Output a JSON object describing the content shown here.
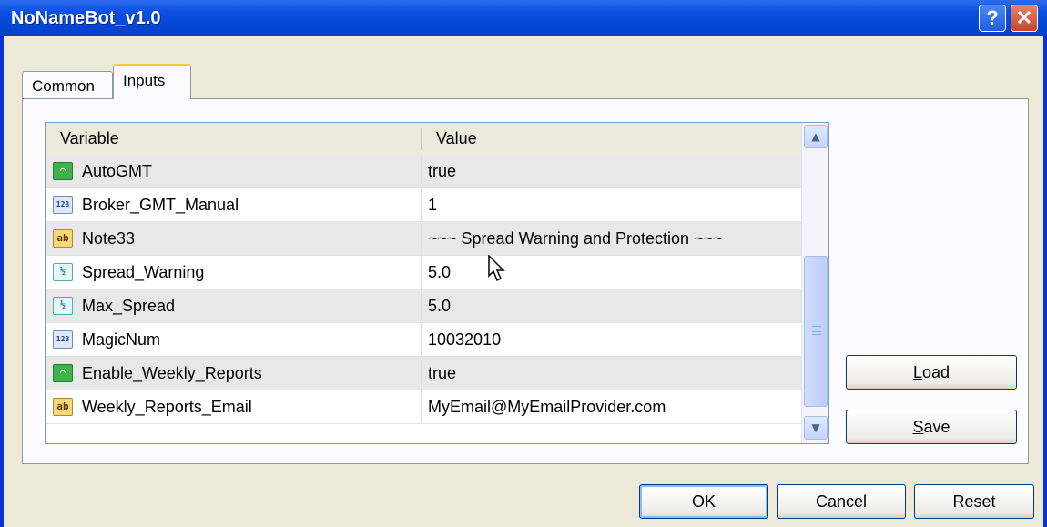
{
  "window": {
    "title": "NoNameBot_v1.0",
    "help_label": "?",
    "close_label": "✕"
  },
  "tabs": [
    {
      "label": "Common",
      "active": false
    },
    {
      "label": "Inputs",
      "active": true
    }
  ],
  "grid": {
    "columns": [
      "Variable",
      "Value"
    ],
    "rows": [
      {
        "icon": "bool",
        "name": "AutoGMT",
        "value": "true"
      },
      {
        "icon": "int",
        "name": "Broker_GMT_Manual",
        "value": "1"
      },
      {
        "icon": "string",
        "name": "Note33",
        "value": "~~~ Spread Warning and Protection ~~~"
      },
      {
        "icon": "double",
        "name": "Spread_Warning",
        "value": "5.0"
      },
      {
        "icon": "double",
        "name": "Max_Spread",
        "value": "5.0"
      },
      {
        "icon": "int",
        "name": "MagicNum",
        "value": "10032010"
      },
      {
        "icon": "bool",
        "name": "Enable_Weekly_Reports",
        "value": "true"
      },
      {
        "icon": "string",
        "name": "Weekly_Reports_Email",
        "value": "MyEmail@MyEmailProvider.com"
      }
    ],
    "icon_glyphs": {
      "bool": "⌒",
      "int": "123",
      "string": "ab",
      "double": "½"
    }
  },
  "side_buttons": {
    "load_label": "Load",
    "load_mnemonic": "L",
    "save_label": "Save",
    "save_mnemonic": "S"
  },
  "footer_buttons": {
    "ok_label": "OK",
    "cancel_label": "Cancel",
    "reset_label": "Reset"
  },
  "colors": {
    "titlebar": "#0646d6",
    "dialog_bg": "#ece9d8",
    "row_alt": "#e8e8e8",
    "tab_active_accent": "#ffc83c"
  }
}
